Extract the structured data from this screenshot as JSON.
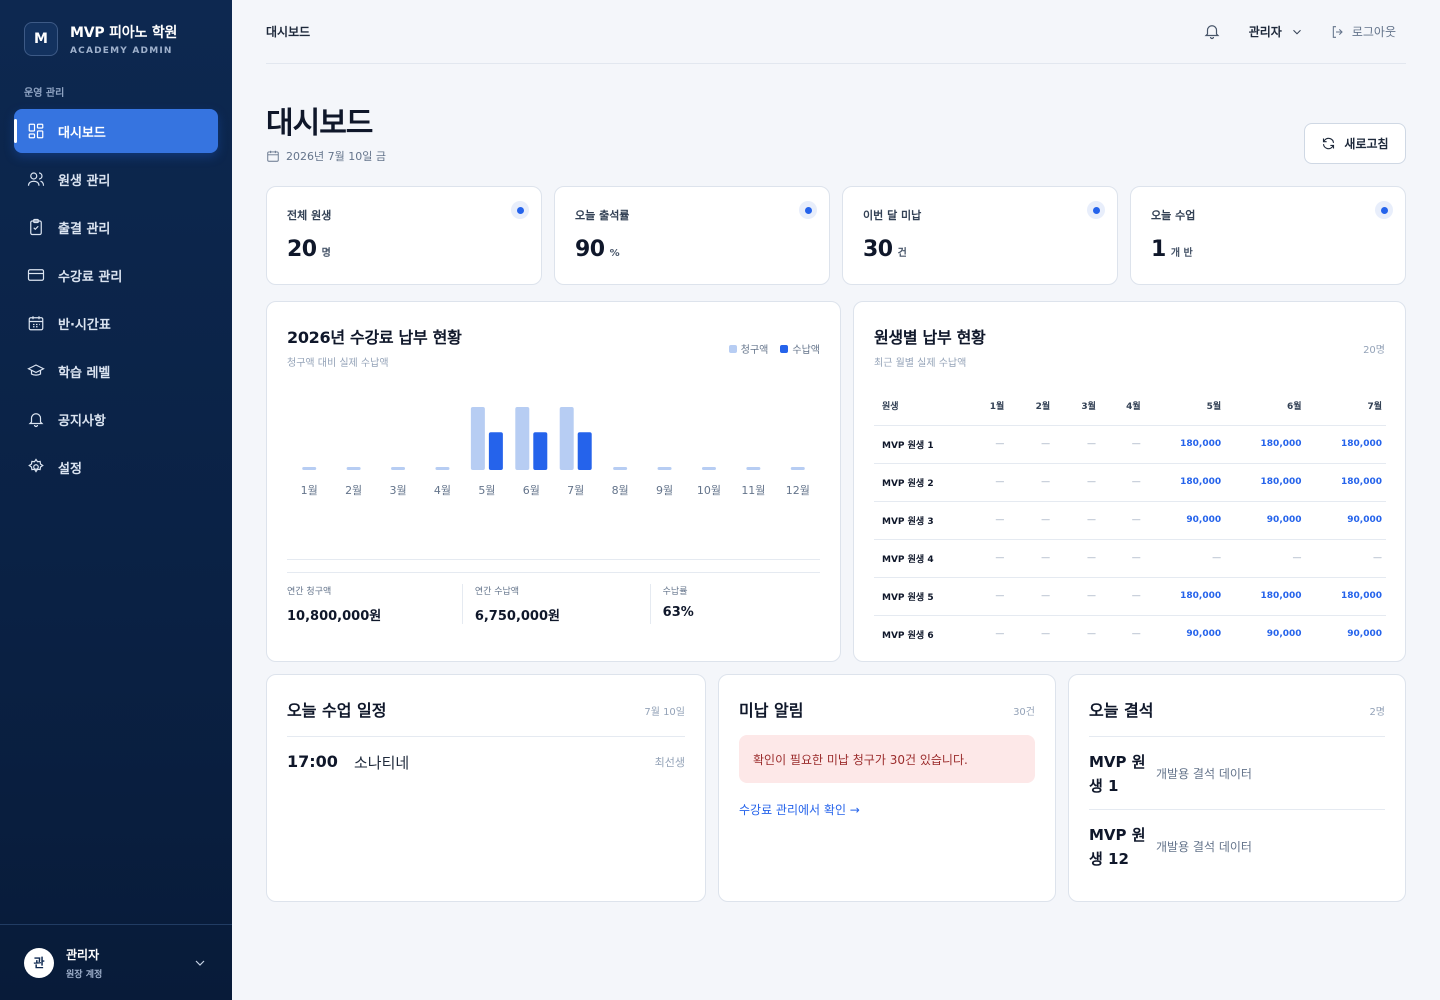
{
  "brand": {
    "logo_letter": "M",
    "name": "MVP 피아노 학원",
    "sub": "ACADEMY ADMIN"
  },
  "sidebar": {
    "section_label": "운영 관리",
    "items": [
      {
        "label": "대시보드",
        "icon": "dashboard-icon",
        "active": true
      },
      {
        "label": "원생 관리",
        "icon": "users-icon"
      },
      {
        "label": "출결 관리",
        "icon": "clipboard-check-icon"
      },
      {
        "label": "수강료 관리",
        "icon": "credit-card-icon"
      },
      {
        "label": "반·시간표",
        "icon": "calendar-icon"
      },
      {
        "label": "학습 레벨",
        "icon": "graduation-cap-icon"
      },
      {
        "label": "공지사항",
        "icon": "bell-icon"
      },
      {
        "label": "설정",
        "icon": "settings-icon"
      }
    ],
    "user": {
      "avatar": "관",
      "name": "관리자",
      "role": "원장 계정"
    }
  },
  "topbar": {
    "breadcrumb": "대시보드",
    "admin_label": "관리자",
    "logout_label": "로그아웃"
  },
  "page": {
    "title": "대시보드",
    "date": "2026년 7월 10일 금",
    "refresh_label": "새로고침"
  },
  "stats": [
    {
      "label": "전체 원생",
      "value": "20",
      "unit": "명"
    },
    {
      "label": "오늘 출석률",
      "value": "90",
      "unit": "%"
    },
    {
      "label": "이번 달 미납",
      "value": "30",
      "unit": "건"
    },
    {
      "label": "오늘 수업",
      "value": "1",
      "unit": "개 반"
    }
  ],
  "fee_chart": {
    "title": "2026년 수강료 납부 현황",
    "subtitle": "청구액 대비 실제 수납액",
    "legend": {
      "billed": "청구액",
      "paid": "수납액"
    },
    "summary": [
      {
        "label": "연간 청구액",
        "value": "10,800,000원"
      },
      {
        "label": "연간 수납액",
        "value": "6,750,000원"
      },
      {
        "label": "수납률",
        "value": "63%"
      }
    ]
  },
  "chart_data": {
    "type": "bar",
    "categories": [
      "1월",
      "2월",
      "3월",
      "4월",
      "5월",
      "6월",
      "7월",
      "8월",
      "9월",
      "10월",
      "11월",
      "12월"
    ],
    "series": [
      {
        "name": "청구액",
        "values": [
          0,
          0,
          0,
          0,
          1080000,
          1080000,
          1080000,
          0,
          0,
          0,
          0,
          0
        ]
      },
      {
        "name": "수납액",
        "values": [
          0,
          0,
          0,
          0,
          648000,
          648000,
          648000,
          0,
          0,
          0,
          0,
          0
        ]
      }
    ],
    "colors": {
      "billed": "#b7cdf3",
      "paid": "#2563eb"
    }
  },
  "student_payments": {
    "title": "원생별 납부 현황",
    "subtitle": "최근 월별 실제 수납액",
    "count": "20명",
    "columns": [
      "원생",
      "1월",
      "2월",
      "3월",
      "4월",
      "5월",
      "6월",
      "7월"
    ],
    "rows": [
      [
        "MVP 원생 1",
        "—",
        "—",
        "—",
        "—",
        "180,000",
        "180,000",
        "180,000"
      ],
      [
        "MVP 원생 2",
        "—",
        "—",
        "—",
        "—",
        "180,000",
        "180,000",
        "180,000"
      ],
      [
        "MVP 원생 3",
        "—",
        "—",
        "—",
        "—",
        "90,000",
        "90,000",
        "90,000"
      ],
      [
        "MVP 원생 4",
        "—",
        "—",
        "—",
        "—",
        "—",
        "—",
        "—"
      ],
      [
        "MVP 원생 5",
        "—",
        "—",
        "—",
        "—",
        "180,000",
        "180,000",
        "180,000"
      ],
      [
        "MVP 원생 6",
        "—",
        "—",
        "—",
        "—",
        "90,000",
        "90,000",
        "90,000"
      ]
    ]
  },
  "schedule": {
    "title": "오늘 수업 일정",
    "date": "7월 10일",
    "items": [
      {
        "time": "17:00",
        "name": "소나티네",
        "teacher": "최선생"
      }
    ]
  },
  "unpaid": {
    "title": "미납 알림",
    "count": "30건",
    "message": "확인이 필요한 미납 청구가 30건 있습니다.",
    "link": "수강료 관리에서 확인 →"
  },
  "absence": {
    "title": "오늘 결석",
    "count": "2명",
    "items": [
      {
        "name": "MVP 원생 1",
        "note": "개발용 결석 데이터"
      },
      {
        "name": "MVP 원생 12",
        "note": "개발용 결석 데이터"
      }
    ]
  },
  "colors": {
    "primary": "#2563eb",
    "sidebar": "#0d2850",
    "active_nav": "#3674e0",
    "alert_bg": "#fde8e8",
    "alert_text": "#9b2c2c"
  }
}
